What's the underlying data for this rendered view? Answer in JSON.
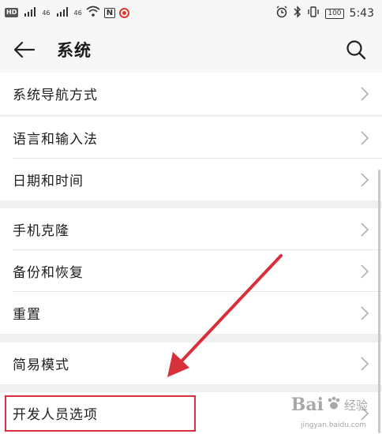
{
  "status_bar": {
    "hd": "HD",
    "sig1": "46",
    "sig2": "46",
    "nfc": "N",
    "battery": "100",
    "time": "5:43"
  },
  "header": {
    "title": "系统"
  },
  "groups": [
    {
      "items": [
        {
          "label": "系统导航方式"
        }
      ]
    },
    {
      "items": [
        {
          "label": "语言和输入法"
        },
        {
          "label": "日期和时间"
        }
      ]
    },
    {
      "items": [
        {
          "label": "手机克隆"
        },
        {
          "label": "备份和恢复"
        },
        {
          "label": "重置"
        }
      ]
    },
    {
      "items": [
        {
          "label": "简易模式"
        }
      ]
    },
    {
      "items": [
        {
          "label": "开发人员选项"
        }
      ]
    }
  ],
  "watermark": {
    "brand": "Bai",
    "brand2": "经验",
    "site": "jingyan.baidu.com"
  },
  "colors": {
    "annotation": "#d8303a",
    "background": "#f0f0f0",
    "row": "#ffffff"
  },
  "icons": [
    "back-arrow-icon",
    "search-icon",
    "chevron-right-icon",
    "wifi-icon",
    "bluetooth-icon",
    "alarm-icon",
    "vibrate-icon",
    "battery-icon",
    "alert-icon"
  ]
}
